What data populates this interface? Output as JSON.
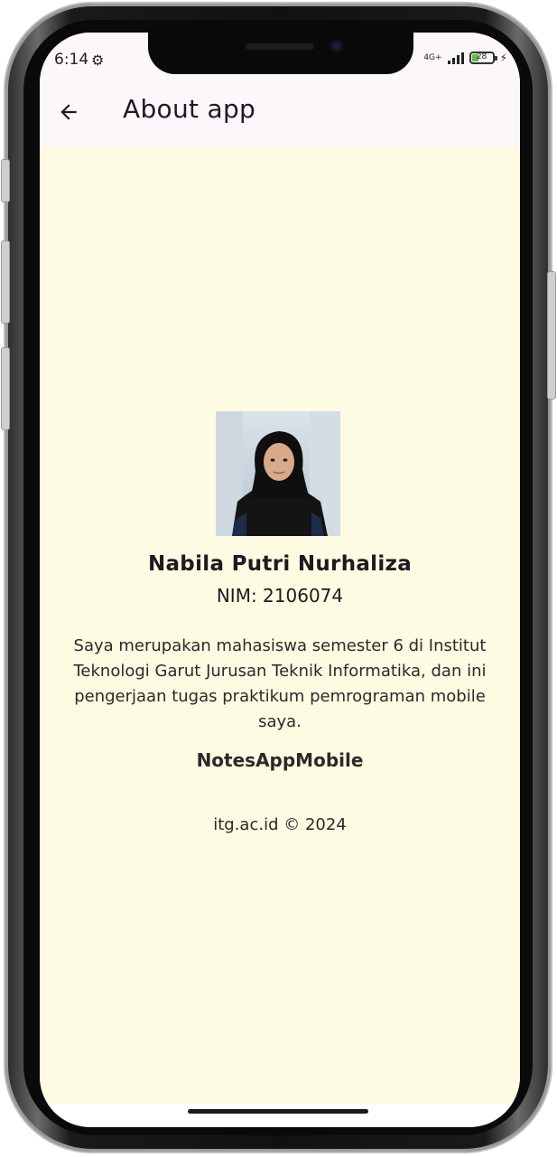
{
  "status_bar": {
    "time": "6:14",
    "network": "4G+",
    "battery_level": "28",
    "icons": [
      "settings-gear-icon",
      "signal-icon",
      "battery-icon",
      "charging-bolt-icon"
    ]
  },
  "app_bar": {
    "back_icon": "arrow-left-icon",
    "title": "About app"
  },
  "profile": {
    "name": "Nabila Putri Nurhaliza",
    "nim": "NIM: 2106074",
    "description": "Saya merupakan mahasiswa semester 6 di Institut Teknologi Garut Jurusan Teknik Informatika, dan ini pengerjaan tugas praktikum pemrograman mobile saya.",
    "app_name": "NotesAppMobile",
    "copyright": "itg.ac.id © 2024"
  },
  "colors": {
    "background": "#fdfbe1",
    "app_bar": "#fbf7fb",
    "text": "#1c1b1f",
    "battery_fill": "#5cc043"
  }
}
